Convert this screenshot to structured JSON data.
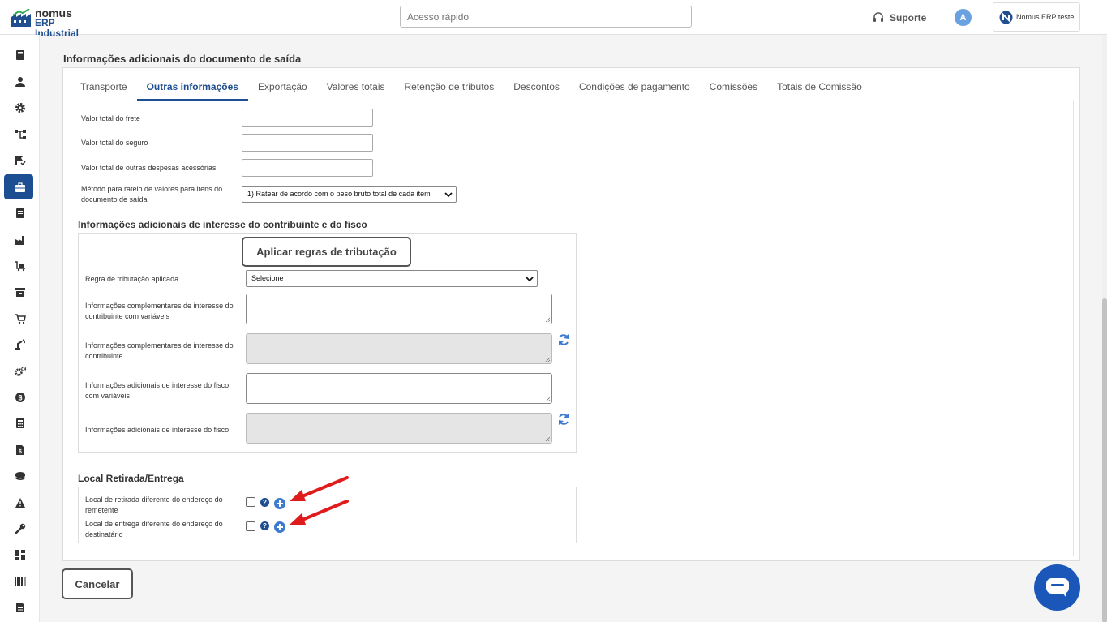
{
  "header": {
    "logo_line1": "nomus",
    "logo_line2": "ERP Industrial",
    "search_placeholder": "Acesso rápido",
    "support_label": "Suporte",
    "avatar_initial": "A",
    "company_name": "Nomus ERP teste"
  },
  "sidebar": {
    "items": [
      {
        "icon": "book-icon"
      },
      {
        "icon": "user-icon"
      },
      {
        "icon": "gear-icon"
      },
      {
        "icon": "hierarchy-icon"
      },
      {
        "icon": "flag-check-icon"
      },
      {
        "icon": "briefcase-icon",
        "active": true
      },
      {
        "icon": "ledger-icon"
      },
      {
        "icon": "factory-icon"
      },
      {
        "icon": "cart-flatbed-icon"
      },
      {
        "icon": "archive-icon"
      },
      {
        "icon": "shopping-cart-icon"
      },
      {
        "icon": "robot-arm-icon"
      },
      {
        "icon": "gears-icon"
      },
      {
        "icon": "dollar-icon"
      },
      {
        "icon": "calculator-icon"
      },
      {
        "icon": "invoice-icon"
      },
      {
        "icon": "coins-icon"
      },
      {
        "icon": "warning-icon"
      },
      {
        "icon": "wrench-icon"
      },
      {
        "icon": "dashboard-icon"
      },
      {
        "icon": "barcode-icon"
      },
      {
        "icon": "document-icon"
      }
    ]
  },
  "section_title": "Informações adicionais do documento de saída",
  "tabs": [
    {
      "label": "Transporte"
    },
    {
      "label": "Outras informações",
      "active": true
    },
    {
      "label": "Exportação"
    },
    {
      "label": "Valores totais"
    },
    {
      "label": "Retenção de tributos"
    },
    {
      "label": "Descontos"
    },
    {
      "label": "Condições de pagamento"
    },
    {
      "label": "Comissões"
    },
    {
      "label": "Totais de Comissão"
    }
  ],
  "fields": {
    "frete_label": "Valor total do frete",
    "frete_value": "",
    "seguro_label": "Valor total do seguro",
    "seguro_value": "",
    "despesas_label": "Valor total de outras despesas acessórias",
    "despesas_value": "",
    "rateio_label": "Método para rateio de valores para itens do documento de saída",
    "rateio_selected": "1) Ratear de acordo com o peso bruto total de cada item"
  },
  "fiscal": {
    "title": "Informações adicionais de interesse do contribuinte e do fisco",
    "apply_button": "Aplicar regras de tributação",
    "regra_label": "Regra de tributação aplicada",
    "regra_selected": "Selecione",
    "contrib_var_label": "Informações complementares de interesse do contribuinte com variáveis",
    "contrib_label": "Informações complementares de interesse do contribuinte",
    "fisco_var_label": "Informações adicionais de interesse do fisco com variáveis",
    "fisco_label": "Informações adicionais de interesse do fisco"
  },
  "local": {
    "title": "Local Retirada/Entrega",
    "retirada_label": "Local de retirada diferente do endereço do remetente",
    "retirada_checked": false,
    "entrega_label": "Local de entrega diferente do endereço do destinatário",
    "entrega_checked": false,
    "help_glyph": "?"
  },
  "colors": {
    "primary": "#1c4e91",
    "arrow": "#e01b1b",
    "chat": "#1b57b8"
  },
  "footer": {
    "cancel_button": "Cancelar"
  }
}
